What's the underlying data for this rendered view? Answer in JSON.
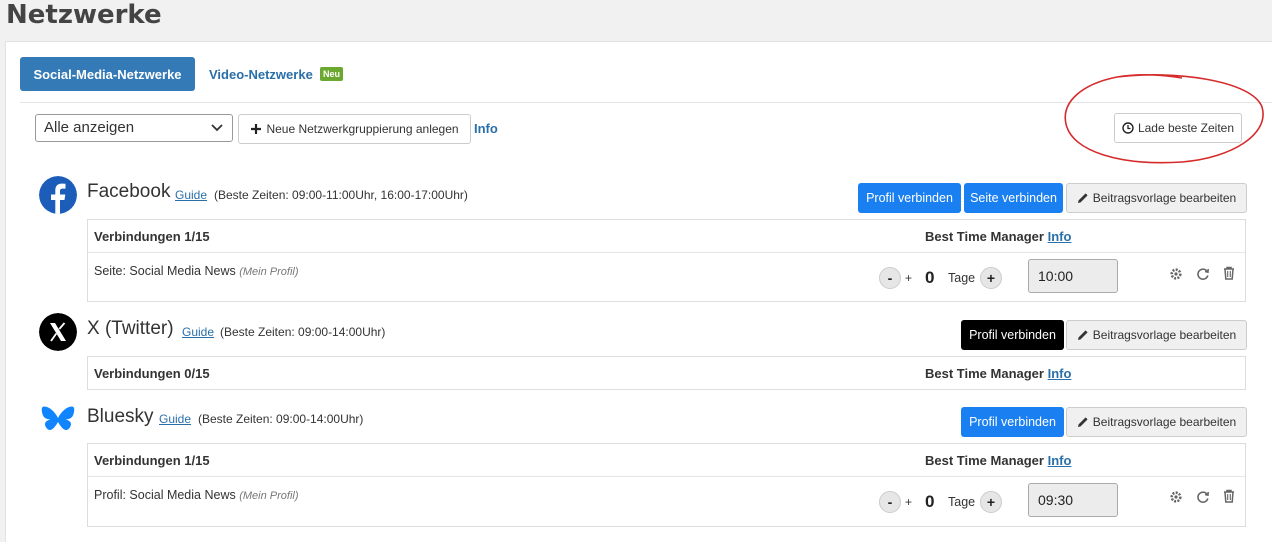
{
  "page_title": "Netzwerke",
  "tabs": [
    {
      "label": "Social-Media-Netzwerke",
      "active": true
    },
    {
      "label": "Video-Netzwerke",
      "badge": "Neu",
      "active": false
    }
  ],
  "toolbar": {
    "filter_value": "Alle anzeigen",
    "new_group_label": "Neue Netzwerkgruppierung anlegen",
    "info_label": "Info",
    "load_best_times_label": "Lade beste Zeiten"
  },
  "networks": [
    {
      "name": "Facebook",
      "guide": "Guide",
      "best_times": "(Beste Zeiten: 09:00-11:00Uhr, 16:00-17:00Uhr)",
      "buttons": [
        "Profil verbinden",
        "Seite verbinden",
        "Beitragsvorlage bearbeiten"
      ],
      "connections_header": "Verbindungen 1/15",
      "btm_header": "Best Time Manager",
      "btm_info": "Info",
      "accounts": [
        {
          "name": "Seite: Social Media News",
          "note": "(Mein Profil)",
          "days": "0",
          "days_label": "Tage",
          "time": "10:00"
        }
      ]
    },
    {
      "name": "X (Twitter)",
      "guide": "Guide",
      "best_times": "(Beste Zeiten: 09:00-14:00Uhr)",
      "buttons": [
        "Profil verbinden",
        "Beitragsvorlage bearbeiten"
      ],
      "connections_header": "Verbindungen 0/15",
      "btm_header": "Best Time Manager",
      "btm_info": "Info",
      "accounts": []
    },
    {
      "name": "Bluesky",
      "guide": "Guide",
      "best_times": "(Beste Zeiten: 09:00-14:00Uhr)",
      "buttons": [
        "Profil verbinden",
        "Beitragsvorlage bearbeiten"
      ],
      "connections_header": "Verbindungen 1/15",
      "btm_header": "Best Time Manager",
      "btm_info": "Info",
      "accounts": [
        {
          "name": "Profil: Social Media News",
          "note": "(Mein Profil)",
          "days": "0",
          "days_label": "Tage",
          "time": "09:30"
        }
      ]
    }
  ],
  "stepper": {
    "minus": "-",
    "plus": "+"
  },
  "colors": {
    "primary": "#337ab7",
    "connect_blue": "#1a7ff0",
    "x_black": "#000000",
    "badge_green": "#6aa830",
    "annotation_red": "#d62b2b"
  }
}
